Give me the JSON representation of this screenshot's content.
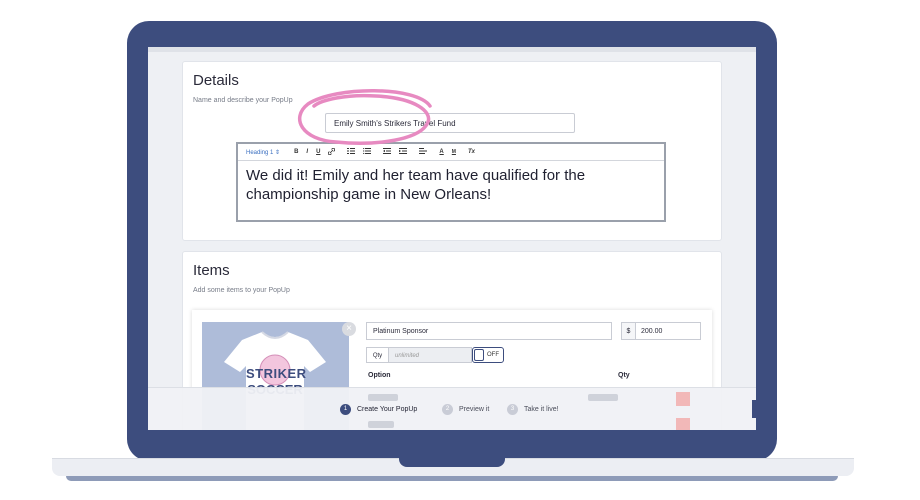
{
  "details": {
    "title": "Details",
    "subtitle": "Name and describe your PopUp",
    "name_value": "Emily Smith's Strikers Travel Fund",
    "editor_text": "We did it! Emily and her team have qualified for the championship game in New Orleans!",
    "toolbar": {
      "heading": "Heading 1",
      "chevron": "⇕",
      "bold": "B",
      "italic": "I",
      "underline": "U",
      "link_icon": "link-icon",
      "clear": "Tx"
    },
    "highlight_color": "#e78ac1"
  },
  "items": {
    "title": "Items",
    "subtitle": "Add some items to your PopUp",
    "product": {
      "name_value": "Platinum Sponsor",
      "currency": "$",
      "price_value": "200.00",
      "qty_label": "Qty",
      "qty_placeholder": "unlimited",
      "toggle_label": "OFF",
      "option_header": "Option",
      "qty_header": "Qty",
      "shirt_text_1": "STRIKER",
      "shirt_text_2": "SOCCER"
    }
  },
  "steps": [
    {
      "num": "1",
      "label": "Create Your PopUp"
    },
    {
      "num": "2",
      "label": "Preview it"
    },
    {
      "num": "3",
      "label": "Take it live!"
    }
  ],
  "colors": {
    "frame": "#3d4d7e",
    "accent_pink": "#e78ac1",
    "editor_blue": "#3b6fc0"
  }
}
